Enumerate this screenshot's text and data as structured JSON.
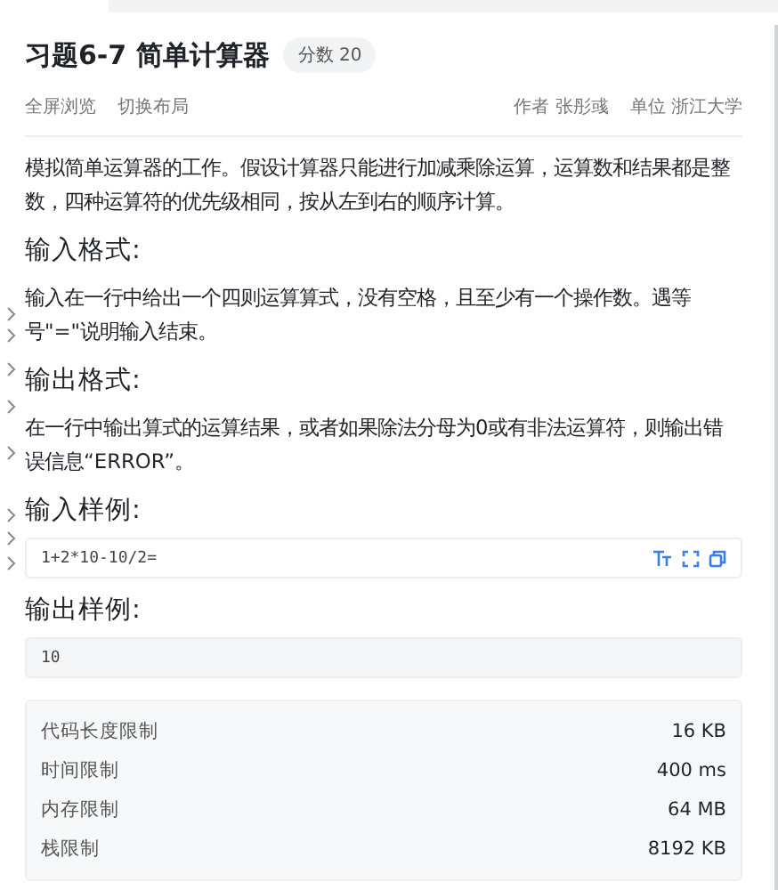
{
  "problem": {
    "title": "习题6-7 简单计算器",
    "score_badge": "分数 20"
  },
  "toolbar": {
    "links": [
      "全屏浏览",
      "切换布局"
    ],
    "author": "作者 张彤彧",
    "unit": "单位 浙江大学"
  },
  "description": "模拟简单运算器的工作。假设计算器只能进行加减乘除运算，运算数和结果都是整数，四种运算符的优先级相同，按从左到右的顺序计算。",
  "sections": [
    {
      "heading": "输入格式:",
      "text": "输入在一行中给出一个四则运算算式，没有空格，且至少有一个操作数。遇等号\"=\"说明输入结束。"
    },
    {
      "heading": "输出格式:",
      "text": "在一行中输出算式的运算结果，或者如果除法分母为0或有非法运算符，则输出错误信息“ERROR”。"
    }
  ],
  "samples": [
    {
      "heading": "输入样例:",
      "code": "1+2*10-10/2=",
      "tools": true
    },
    {
      "heading": "输出样例:",
      "code": "10",
      "tools": false
    }
  ],
  "limits": [
    {
      "label": "代码长度限制",
      "value": "16 KB"
    },
    {
      "label": "时间限制",
      "value": "400 ms"
    },
    {
      "label": "内存限制",
      "value": "64 MB"
    },
    {
      "label": "栈限制",
      "value": "8192 KB"
    }
  ]
}
